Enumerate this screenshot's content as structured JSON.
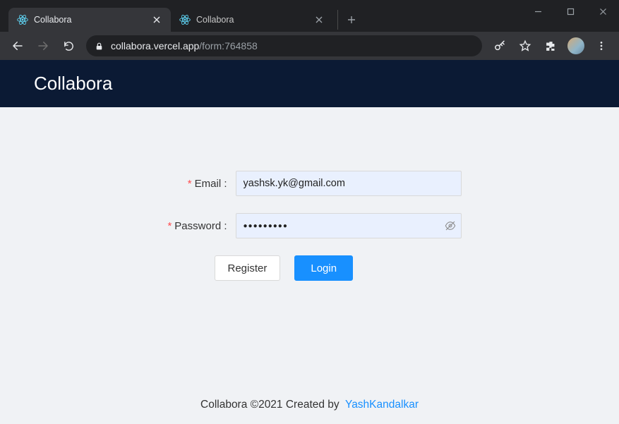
{
  "browser": {
    "tabs": [
      {
        "title": "Collabora",
        "active": true
      },
      {
        "title": "Collabora",
        "active": false
      }
    ],
    "url": {
      "host": "collabora.vercel.app",
      "path": "/form:764858"
    }
  },
  "header": {
    "title": "Collabora"
  },
  "form": {
    "email": {
      "label": "Email",
      "value": "yashsk.yk@gmail.com"
    },
    "password": {
      "label": "Password",
      "value": "●●●●●●●●●"
    },
    "register_label": "Register",
    "login_label": "Login"
  },
  "footer": {
    "text": "Collabora ©2021 Created by",
    "link_text": "YashKandalkar"
  }
}
